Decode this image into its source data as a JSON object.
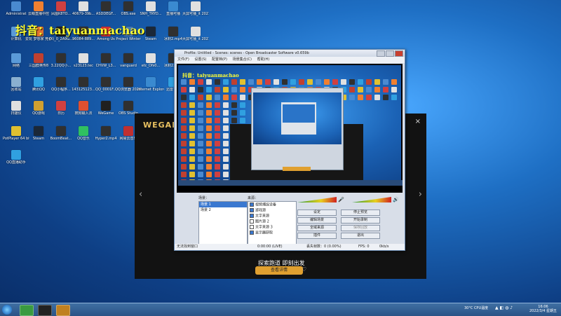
{
  "watermark": "抖音：taiyuanmachao",
  "desktop_icons": [
    {
      "label": "Administrat",
      "color": "#4a8ad0",
      "icon": "user-folder-icon"
    },
    {
      "label": "云萌直播中控",
      "color": "#f08030",
      "icon": "app-icon"
    },
    {
      "label": "凤凰K8TO...",
      "color": "#d04040",
      "icon": "app-icon"
    },
    {
      "label": "40679-39b...",
      "color": "#e0e0e0",
      "icon": "file-icon"
    },
    {
      "label": "ASDDEGF...",
      "color": "#303030",
      "icon": "file-icon"
    },
    {
      "label": "OBS.exe",
      "color": "#303030",
      "icon": "obs-icon"
    },
    {
      "label": "SNH_TRYD...",
      "color": "#e0e0e0",
      "icon": "file-icon"
    },
    {
      "label": "直播可播",
      "color": "#3a8ad0",
      "icon": "app-icon"
    },
    {
      "label": "大屏可播_it 2021大屏...",
      "color": "#e0e0e0",
      "icon": "file-icon"
    },
    {
      "label": "计算机",
      "color": "#5a9ad8",
      "icon": "computer-icon"
    },
    {
      "label": "爱玩 梦想家 竞价跑通软件",
      "color": "#e07030",
      "icon": "app-icon"
    },
    {
      "label": "(X)_0_2A9G...",
      "color": "#202020",
      "icon": "file-icon"
    },
    {
      "label": "96084-889...",
      "color": "#303030",
      "icon": "file-icon"
    },
    {
      "label": "Among Us",
      "color": "#d03030",
      "icon": "game-icon"
    },
    {
      "label": "Project Winter",
      "color": "#4a7ab0",
      "icon": "game-icon"
    },
    {
      "label": "Steam",
      "color": "#1b2838",
      "icon": "steam-icon"
    },
    {
      "label": "冰封2.mp4",
      "color": "#303030",
      "icon": "video-icon"
    },
    {
      "label": "大屏可播_it 2021大屏...",
      "color": "#e0e0e0",
      "icon": "file-icon"
    },
    {
      "label": "网络",
      "color": "#5a9ad8",
      "icon": "network-icon"
    },
    {
      "label": "三国群英传8",
      "color": "#c04030",
      "icon": "game-icon"
    },
    {
      "label": "3.22QQ小...",
      "color": "#303030",
      "icon": "file-icon"
    },
    {
      "label": "s23123.tec",
      "color": "#e0e0e0",
      "icon": "file-icon"
    },
    {
      "label": "CHVW_L3...",
      "color": "#303030",
      "icon": "file-icon"
    },
    {
      "label": "vanguard",
      "color": "#303030",
      "icon": "file-icon"
    },
    {
      "label": "etc_Dfs0...",
      "color": "#e0e0e0",
      "icon": "file-icon"
    },
    {
      "label": "冰封2.mp4",
      "color": "#303030",
      "icon": "video-icon"
    },
    {
      "label": "回收站",
      "color": "#8ab0d0",
      "icon": "recycle-bin-icon"
    },
    {
      "label": "腾讯QQ",
      "color": "#30a0e0",
      "icon": "qq-icon"
    },
    {
      "label": "QQ小程序...",
      "color": "#303030",
      "icon": "file-icon"
    },
    {
      "label": "143125123...",
      "color": "#303030",
      "icon": "file-icon"
    },
    {
      "label": "QQ_0001F...",
      "color": "#303030",
      "icon": "file-icon"
    },
    {
      "label": "QQ浏览器 2020...",
      "color": "#303030",
      "icon": "file-icon"
    },
    {
      "label": "Internet Explorer",
      "color": "#3a8ad0",
      "icon": "ie-icon"
    },
    {
      "label": "迅雷下载",
      "color": "#30a0e0",
      "icon": "app-icon"
    },
    {
      "label": "扫描仪",
      "color": "#e0e0e0",
      "icon": "file-icon"
    },
    {
      "label": "QQ游戏",
      "color": "#d0a030",
      "icon": "app-icon"
    },
    {
      "label": "日历",
      "color": "#d04040",
      "icon": "app-icon"
    },
    {
      "label": "搜狗输入法",
      "color": "#e05030",
      "icon": "app-icon"
    },
    {
      "label": "WeGame",
      "color": "#202020",
      "icon": "wegame-icon"
    },
    {
      "label": "OBS Studio",
      "color": "#303030",
      "icon": "obs-icon"
    },
    {
      "label": "PotPlayer 64 bit",
      "color": "#e0c030",
      "icon": "app-icon"
    },
    {
      "label": "Steam",
      "color": "#1b2838",
      "icon": "steam-icon"
    },
    {
      "label": "BoomBeat...",
      "color": "#303030",
      "icon": "file-icon"
    },
    {
      "label": "QQ音乐",
      "color": "#30c060",
      "icon": "app-icon"
    },
    {
      "label": "Hyper2.mp4",
      "color": "#303030",
      "icon": "video-icon"
    },
    {
      "label": "网易云音乐",
      "color": "#c03030",
      "icon": "app-icon"
    },
    {
      "label": "QQ直播助手",
      "color": "#30a0e0",
      "icon": "app-icon"
    }
  ],
  "wegame": {
    "logo": "WEGAME",
    "promo": "探索跑道 即刻出发",
    "button": "查看详情",
    "close": "×",
    "left_arrow": "‹",
    "right_arrow": "›"
  },
  "obs": {
    "title": "Profile: Untitled - Scenes: scenes - Open Broadcaster Software v0.659b",
    "menu": [
      "文件(F)",
      "设置(S)",
      "配置档(P)",
      "场景集合(C)",
      "帮助(H)"
    ],
    "scenes_label": "场景：",
    "sources_label": "来源：",
    "scenes": [
      "场景 1",
      "场景 2"
    ],
    "sources": [
      {
        "label": "视频捕捉设备",
        "checked": true
      },
      {
        "label": "游戏源",
        "checked": true
      },
      {
        "label": "文字来源",
        "checked": true
      },
      {
        "label": "图片源 2",
        "checked": false
      },
      {
        "label": "文字来源 3",
        "checked": false
      },
      {
        "label": "显示器获取",
        "checked": true
      }
    ],
    "buttons": {
      "settings": "设定",
      "stop_preview": "停止预览",
      "edit_scene": "编辑场景",
      "start_recording": "开始录制",
      "global_sources": "全域来源",
      "replay_buffer": "保存回放",
      "plugins": "插件",
      "exit": "退出"
    },
    "status": {
      "left": "无法找到窗口",
      "time": "0:00:00 (LIVE)",
      "dropped": "丢失帧数：0 (0.00%)",
      "fps": "FPS: 0",
      "kbps": "0kb/s"
    }
  },
  "taskbar": {
    "tray_text": "30°C CPU温度",
    "time": "16:06",
    "date": "2022/3/4 星期五"
  }
}
